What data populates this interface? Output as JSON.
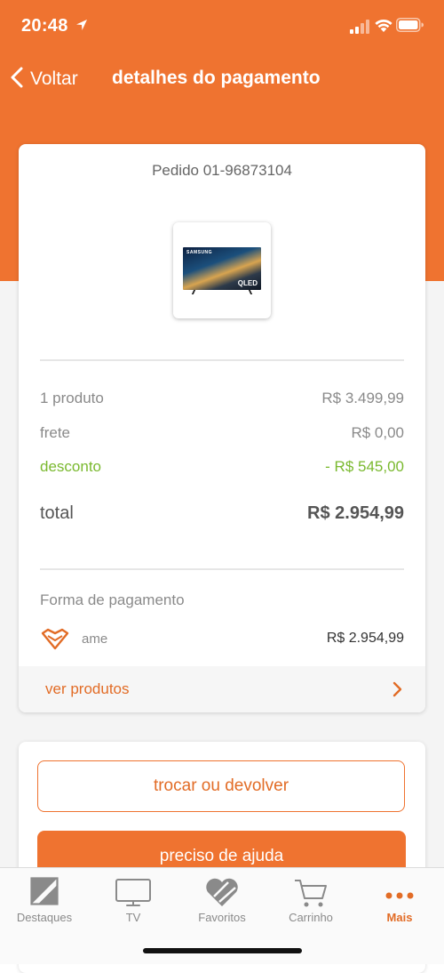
{
  "status_bar": {
    "time": "20:48"
  },
  "header": {
    "back_label": "Voltar",
    "title": "detalhes do pagamento"
  },
  "order": {
    "number_label": "Pedido 01-96873104",
    "product_image": {
      "brand": "SAMSUNG",
      "badge": "QLED"
    },
    "summary": [
      {
        "label": "1 produto",
        "value": "R$ 3.499,99"
      },
      {
        "label": "frete",
        "value": "R$ 0,00"
      },
      {
        "label": "desconto",
        "value": "- R$ 545,00"
      }
    ],
    "total": {
      "label": "total",
      "value": "R$ 2.954,99"
    },
    "payment": {
      "title": "Forma de pagamento",
      "method": "ame",
      "method_icon": "ame-heart-icon",
      "amount": "R$ 2.954,99"
    },
    "view_products_label": "ver produtos"
  },
  "actions": {
    "exchange_label": "trocar ou devolver",
    "help_label": "preciso de ajuda"
  },
  "tabs": [
    {
      "label": "Destaques",
      "icon": "highlights-icon",
      "active": false
    },
    {
      "label": "TV",
      "icon": "tv-icon",
      "active": false
    },
    {
      "label": "Favoritos",
      "icon": "heart-icon",
      "active": false
    },
    {
      "label": "Carrinho",
      "icon": "cart-icon",
      "active": false
    },
    {
      "label": "Mais",
      "icon": "more-icon",
      "active": true
    }
  ],
  "colors": {
    "brand": "#ef7330",
    "discount": "#7ab92f",
    "link": "#e26c26"
  }
}
